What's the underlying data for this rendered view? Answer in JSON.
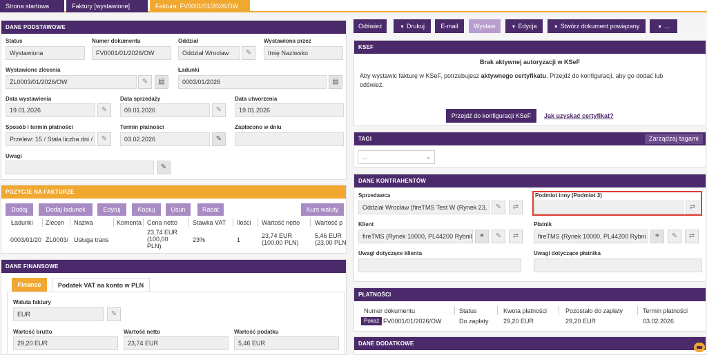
{
  "tabs": [
    {
      "label": "Strona startowa"
    },
    {
      "label": "Faktury [wystawione]"
    },
    {
      "label": "Faktura: FV0001/01/2026/OW"
    }
  ],
  "toolbar": {
    "refresh": "Odśwież",
    "print": "Drukuj",
    "email": "E-mail",
    "issue": "Wystaw",
    "edit": "Edycja",
    "create_related": "Stwórz dokument powiązany",
    "more": "..."
  },
  "dane_podstawowe": {
    "header": "DANE PODSTAWOWE",
    "status_label": "Status",
    "status": "Wystawiona",
    "numer_label": "Numer dokumentu",
    "numer": "FV0001/01/2026/OW",
    "oddzial_label": "Oddział",
    "oddzial": "Oddział Wrocław",
    "wystawiona_przez_label": "Wystawiona przez",
    "wystawiona_przez": "Imię Naziwsko",
    "zlecenie_label": "Wystawione zlecenia",
    "zlecenie": "ZL0003/01/2026/OW",
    "ladunki_label": "Ładunki",
    "ladunki": "0003/01/2026",
    "data_wystawienia_label": "Data wystawienia",
    "data_wystawienia": "19.01.2026",
    "data_sprzedazy_label": "Data sprzedaży",
    "data_sprzedazy": "09.01.2026",
    "data_utworzenia_label": "Data utworzenia",
    "data_utworzenia": "19.01.2026",
    "sposob_label": "Sposób i termin płatności",
    "sposob": "Przelew: 15 / Stała liczba dni /",
    "termin_label": "Termin płatności",
    "termin": "03.02.2026",
    "zaplacono_label": "Zapłacono w dniu",
    "zaplacono": "",
    "uwagi_label": "Uwagi",
    "uwagi": ""
  },
  "pozycje": {
    "header": "POZYCJE NA FAKTURZE",
    "buttons": {
      "dodaj": "Dodaj",
      "dodaj_ladunek": "Dodaj ładunek",
      "edytuj": "Edytuj",
      "kopiuj": "Kopiuj",
      "usun": "Usuń",
      "rabat": "Rabat",
      "kurs": "Kurs waluty"
    },
    "columns": [
      "Ładunki",
      "Zlecen",
      "Nazwa",
      "Komenta",
      "Cena netto",
      "Stawka VAT",
      "Ilości",
      "Wartość netto",
      "Wartość p"
    ],
    "row": {
      "ladunki": "0003/01/20",
      "zlecenie": "ZL0003/",
      "nazwa": "Usługa trans",
      "cena_1": "23,74 EUR",
      "cena_2": "(100,00",
      "cena_3": "PLN)",
      "stawka": "23%",
      "ilosc": "1",
      "wartosc_netto_1": "23,74 EUR",
      "wartosc_netto_2": "(100,00 PLN)",
      "wartosc_p_1": "5,46 EUR",
      "wartosc_p_2": "(23,00 PLN"
    }
  },
  "finansowe": {
    "header": "DANE FINANSOWE",
    "tab_finanse": "Finanse",
    "tab_vat": "Podatek VAT na konto w PLN",
    "waluta_label": "Waluta faktury",
    "waluta": "EUR",
    "brutto_label": "Wartość brutto",
    "brutto": "29,20 EUR",
    "netto_label": "Wartość netto",
    "netto": "23,74 EUR",
    "podatek_label": "Wartość podatku",
    "podatek": "5,46 EUR"
  },
  "ksef": {
    "header": "KSEF",
    "title": "Brak aktywnej autoryzacji w KSeF",
    "msg_1": "Aby wystawic fakturę w KSeF, potrzebujesz",
    "msg_bold": "aktywnego certyfikatu",
    "msg_2": ". Przejdź do konfiguracji, aby go dodać lub",
    "msg_3": "odśwież.",
    "config_button": "Przejdź do konfiguracji KSeF",
    "cert_link": "Jak uzyskać certyfikat?"
  },
  "tagi": {
    "header": "TAGI",
    "manage": "Zarządzaj tagami",
    "select": "..."
  },
  "kontrahenci": {
    "header": "DANE KONTRAHENTÓW",
    "sprzedawca_label": "Sprzedawca",
    "sprzedawca": "Oddział Wrocław (fireTMS Test W (Rynek 23,",
    "podmiot_label": "Podmiot inny (Podmiot 3)",
    "podmiot": "",
    "klient_label": "Klient",
    "klient": "fireTMS (Rynek 10000, PL44200 Rybnil",
    "platnik_label": "Płatnik",
    "platnik": "fireTMS (Rynek 10000, PL44200 Rybni",
    "uwagi_klient_label": "Uwagi dotyczące klienta",
    "uwagi_platnik_label": "Uwagi dotyczące płatnika"
  },
  "platnosci": {
    "header": "PŁATNOŚCI",
    "columns": [
      "Numer dokumentu",
      "Status",
      "Kwota płatności",
      "Pozostało do zapłaty",
      "Termin płatności"
    ],
    "show": "Pokaż",
    "numer": "FV0001/01/2026/OW",
    "status": "Do zapłaty",
    "kwota": "29,20 EUR",
    "pozostalo": "29,20 EUR",
    "termin": "03.02.2026"
  },
  "dodatkowe": {
    "header": "DANE DODATKOWE"
  },
  "colors": {
    "primary": "#4b2a6b",
    "accent": "#f0a830",
    "button_light": "#a98bc4",
    "highlight": "#e03c31"
  }
}
